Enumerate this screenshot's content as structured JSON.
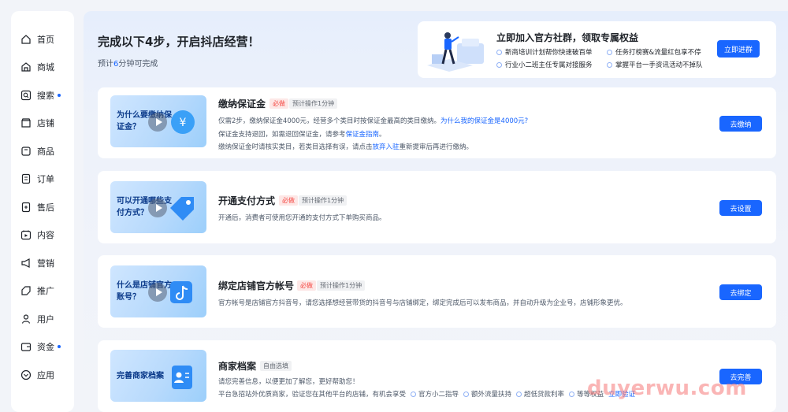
{
  "sidebar": {
    "items": [
      {
        "label": "首页",
        "icon": "home-icon",
        "dot": false
      },
      {
        "label": "商城",
        "icon": "store-icon",
        "dot": false
      },
      {
        "label": "搜索",
        "icon": "search-icon",
        "dot": true
      },
      {
        "label": "店铺",
        "icon": "shop-icon",
        "dot": false
      },
      {
        "label": "商品",
        "icon": "product-icon",
        "dot": false
      },
      {
        "label": "订单",
        "icon": "order-icon",
        "dot": false
      },
      {
        "label": "售后",
        "icon": "after-sales-icon",
        "dot": false
      },
      {
        "label": "内容",
        "icon": "content-icon",
        "dot": false
      },
      {
        "label": "营销",
        "icon": "megaphone-icon",
        "dot": false
      },
      {
        "label": "推广",
        "icon": "promote-icon",
        "dot": false
      },
      {
        "label": "用户",
        "icon": "user-icon",
        "dot": false
      },
      {
        "label": "资金",
        "icon": "wallet-icon",
        "dot": true
      },
      {
        "label": "应用",
        "icon": "apps-icon",
        "dot": false
      }
    ],
    "accent": "#1966ff"
  },
  "header": {
    "title": "完成以下4步，开启抖店经营！",
    "subtitle_prefix": "预计",
    "subtitle_num": "6",
    "subtitle_suffix": "分钟可完成"
  },
  "promo": {
    "title": "立即加入官方社群，领取专属权益",
    "bullets": [
      "新商培训计划帮你快速破百单",
      "任务打榜赛&流量红包享不停",
      "行业小二班主任专属对接服务",
      "掌握平台一手资讯活动不掉队"
    ],
    "button": "立即进群"
  },
  "cards": [
    {
      "thumb_text": "为什么要缴纳保证金？",
      "title": "缴纳保证金",
      "tag": "必做",
      "time": "预计操作1分钟",
      "line1_a": "仅需2步，缴纳保证金4000元，经营多个类目时按保证金最高的类目缴纳。",
      "line1_link": "为什么我的保证金是4000元?",
      "line2_a": "保证金支持退回，如需退回保证金，请参考",
      "line2_link": "保证金指南",
      "line2_b": "。",
      "line3_a": "缴纳保证金时请核实类目，若类目选择有误，请点击",
      "line3_link": "放弃入驻",
      "line3_b": "重新提审后再进行缴纳。",
      "button": "去缴纳"
    },
    {
      "thumb_text": "可以开通哪些支付方式？",
      "title": "开通支付方式",
      "tag": "必做",
      "time": "预计操作1分钟",
      "line1": "开通后，消费者可使用您开通的支付方式下单购买商品。",
      "button": "去设置"
    },
    {
      "thumb_text": "什么是店铺官方账号？",
      "title": "绑定店铺官方帐号",
      "tag": "必做",
      "time": "预计操作1分钟",
      "line1": "官方帐号是店铺官方抖音号，请您选择想经营带货的抖音号与店铺绑定，绑定完成后可以发布商品，并自动升级为企业号，店铺形象更优。",
      "button": "去绑定"
    },
    {
      "thumb_text": "完善商家档案",
      "title": "商家档案",
      "tag": "自由选填",
      "line1": "请您完善信息，以便更加了解您，更好帮助您！",
      "line2": "平台急招站外优质商家，验证您在其他平台的店铺，有机会享受",
      "perks": [
        "官方小二指导",
        "额外流量扶持",
        "超低贷款利率",
        "等等权益"
      ],
      "line2_link": "立即验证",
      "button": "去完善"
    }
  ],
  "watermark": "duyerwu.com"
}
